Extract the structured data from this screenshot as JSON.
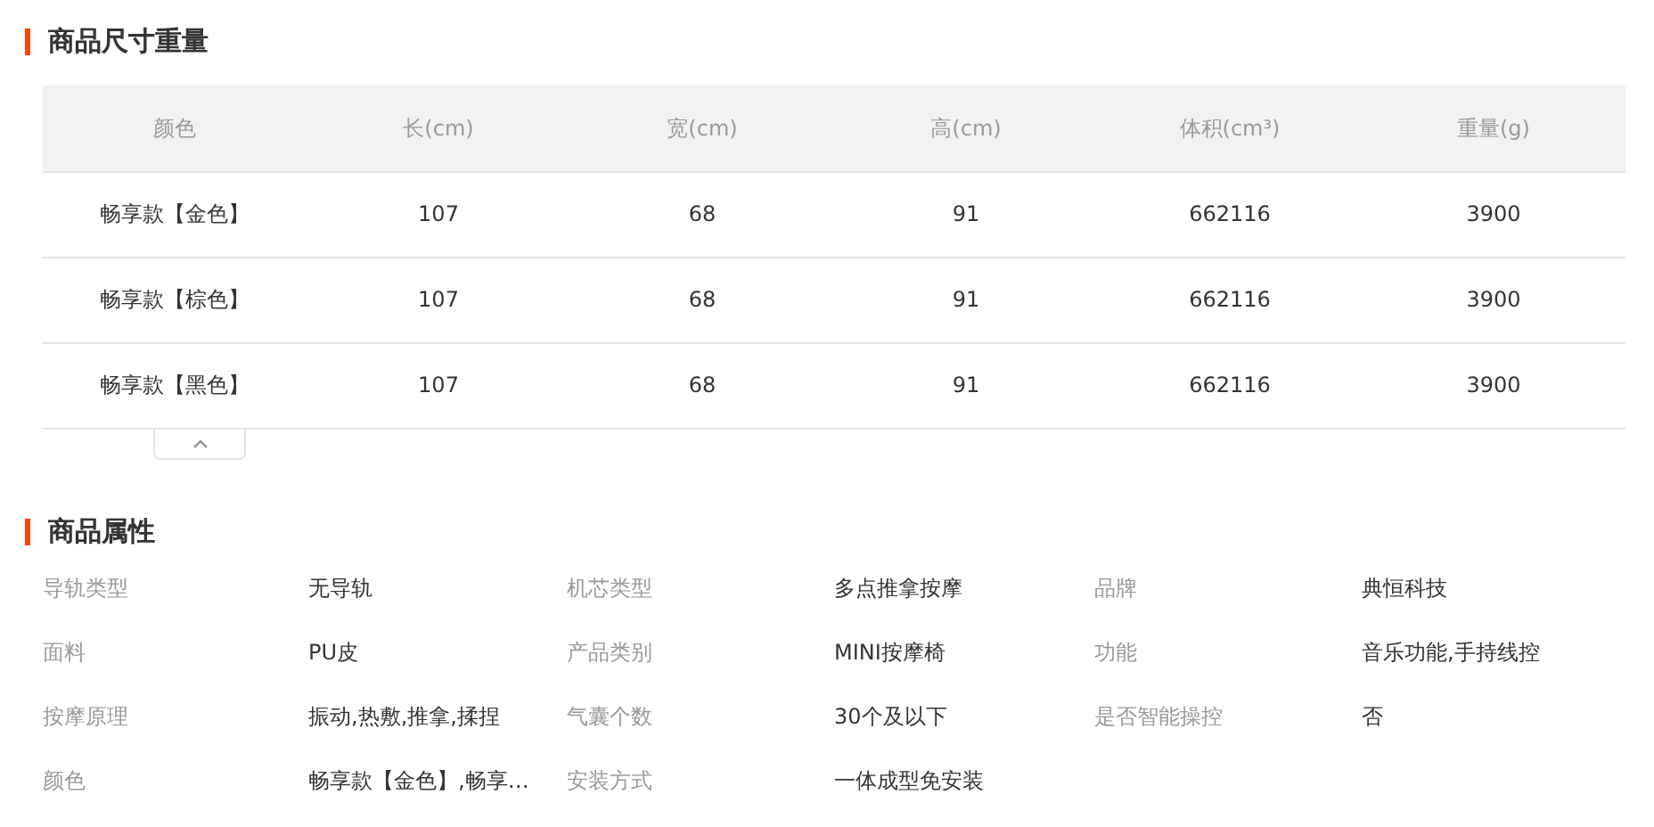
{
  "size_section": {
    "title": "商品尺寸重量",
    "table": {
      "columns": [
        "颜色",
        "长(cm)",
        "宽(cm)",
        "高(cm)",
        "体积(cm³)",
        "重量(g)"
      ],
      "rows": [
        [
          "畅享款【金色】",
          "107",
          "68",
          "91",
          "662116",
          "3900"
        ],
        [
          "畅享款【棕色】",
          "107",
          "68",
          "91",
          "662116",
          "3900"
        ],
        [
          "畅享款【黑色】",
          "107",
          "68",
          "91",
          "662116",
          "3900"
        ]
      ]
    },
    "collapse_toggle": {
      "expanded": true
    }
  },
  "attributes_section": {
    "title": "商品属性",
    "attributes": [
      {
        "label": "导轨类型",
        "value": "无导轨"
      },
      {
        "label": "机芯类型",
        "value": "多点推拿按摩"
      },
      {
        "label": "品牌",
        "value": "典恒科技"
      },
      {
        "label": "面料",
        "value": "PU皮"
      },
      {
        "label": "产品类别",
        "value": "MINI按摩椅"
      },
      {
        "label": "功能",
        "value": "音乐功能,手持线控"
      },
      {
        "label": "按摩原理",
        "value": "振动,热敷,推拿,揉捏"
      },
      {
        "label": "气囊个数",
        "value": "30个及以下"
      },
      {
        "label": "是否智能操控",
        "value": "否"
      },
      {
        "label": "颜色",
        "value": "畅享款【金色】,畅享…"
      },
      {
        "label": "安装方式",
        "value": "一体成型免安装"
      }
    ]
  }
}
